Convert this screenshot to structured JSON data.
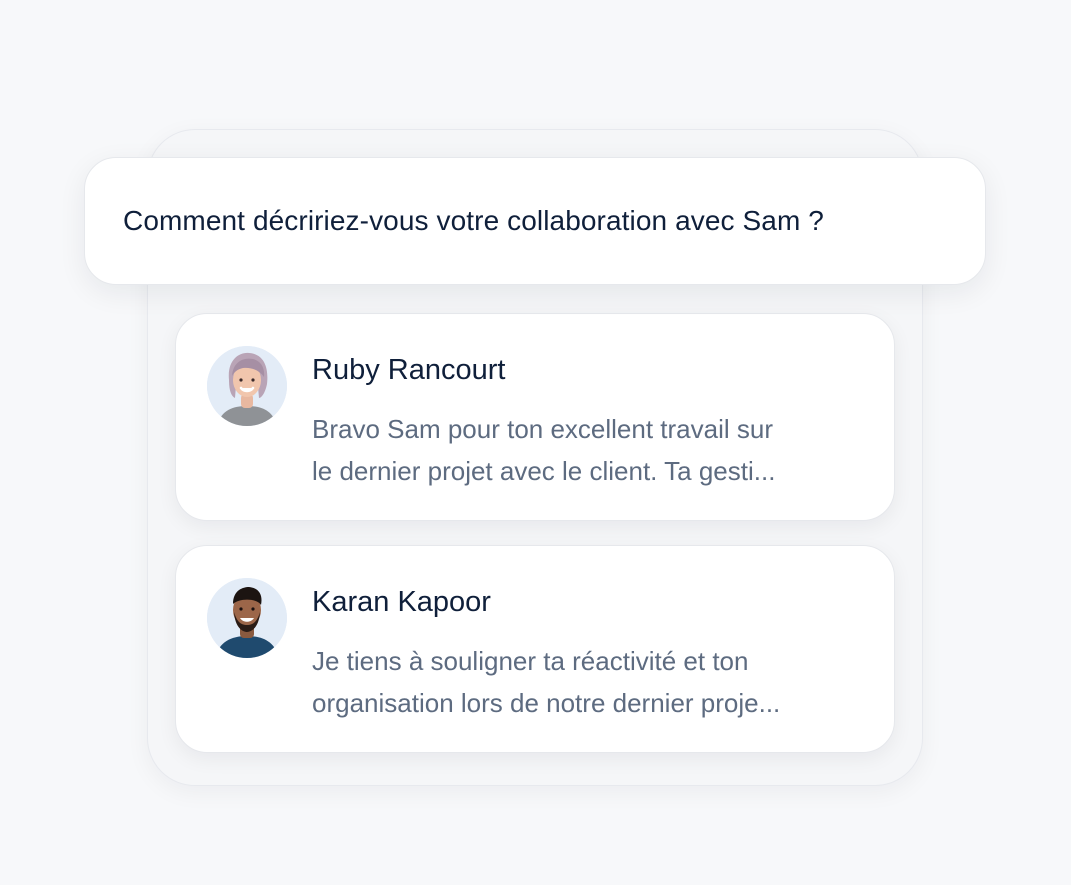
{
  "question": {
    "text": "Comment décririez-vous votre collaboration avec Sam ?"
  },
  "feedback": [
    {
      "name": "Ruby Rancourt",
      "avatar": "avatar-photo-woman-icon",
      "message_line1": "Bravo Sam pour ton excellent travail sur",
      "message_line2": "le dernier projet avec le client. Ta gesti..."
    },
    {
      "name": "Karan Kapoor",
      "avatar": "avatar-photo-man-icon",
      "message_line1": "Je tiens à souligner ta réactivité et ton",
      "message_line2": "organisation lors de notre dernier proje..."
    }
  ],
  "colors": {
    "background": "#f7f8fa",
    "card": "#ffffff",
    "title_text": "#0f1f3a",
    "body_text": "#5d6b80",
    "avatar_background": "#e3ecf7"
  }
}
